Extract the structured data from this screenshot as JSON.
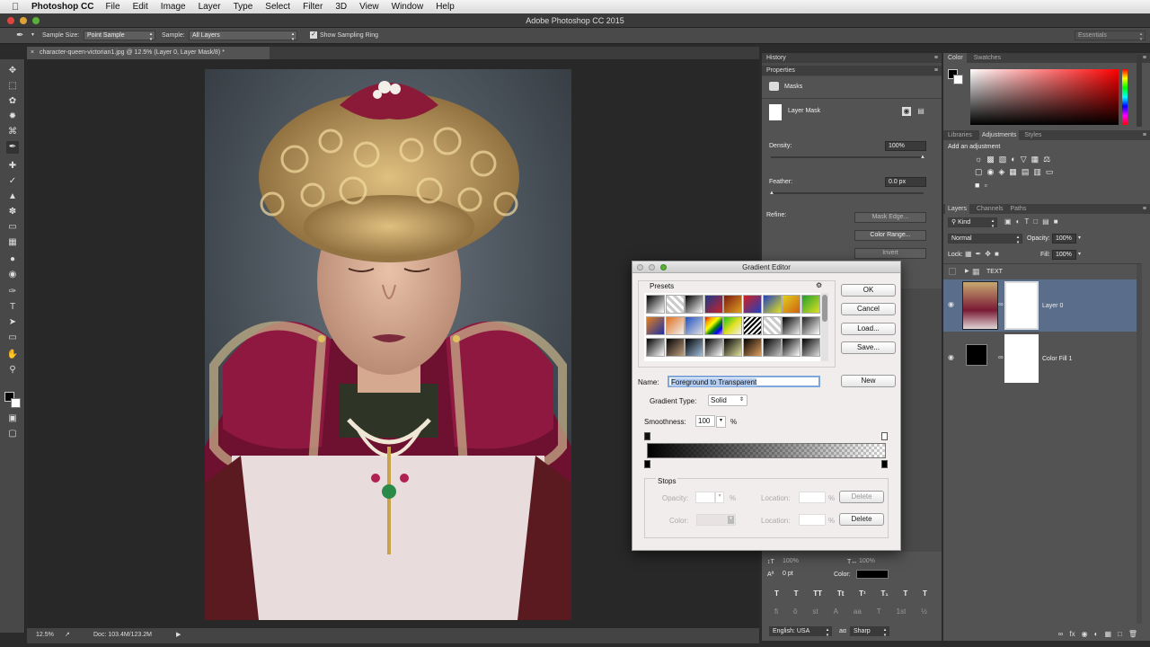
{
  "menubar": {
    "app_name": "Photoshop CC",
    "items": [
      "File",
      "Edit",
      "Image",
      "Layer",
      "Type",
      "Select",
      "Filter",
      "3D",
      "View",
      "Window",
      "Help"
    ]
  },
  "window_title": "Adobe Photoshop CC 2015",
  "options_bar": {
    "sample_size_label": "Sample Size:",
    "sample_size_value": "Point Sample",
    "sample_label": "Sample:",
    "sample_value": "All Layers",
    "show_ring_label": "Show Sampling Ring",
    "workspace": "Essentials"
  },
  "document_tab": "character-queen-victorian1.jpg @ 12.5% (Layer 0, Layer Mask/8) *",
  "status_bar": {
    "zoom": "12.5%",
    "doc_size": "Doc: 103.4M/123.2M"
  },
  "history_panel": {
    "title": "History"
  },
  "properties_panel": {
    "title": "Properties",
    "masks_label": "Masks",
    "layer_mask_label": "Layer Mask",
    "density_label": "Density:",
    "density_value": "100%",
    "feather_label": "Feather:",
    "feather_value": "0.0 px",
    "refine_label": "Refine:",
    "mask_edge_button": "Mask Edge...",
    "color_range_button": "Color Range...",
    "invert_button": "Invert"
  },
  "color_panel": {
    "tabs": [
      "Color",
      "Swatches"
    ]
  },
  "adjustments_panel": {
    "tabs": [
      "Libraries",
      "Adjustments",
      "Styles"
    ],
    "add_label": "Add an adjustment"
  },
  "layers_panel": {
    "tabs": [
      "Layers",
      "Channels",
      "Paths"
    ],
    "kind_filter": "Kind",
    "blend_mode": "Normal",
    "opacity_label": "Opacity:",
    "opacity_value": "100%",
    "lock_label": "Lock:",
    "fill_label": "Fill:",
    "fill_value": "100%",
    "layers": [
      {
        "name": "TEXT"
      },
      {
        "name": "Layer 0"
      },
      {
        "name": "Color Fill 1"
      }
    ]
  },
  "character_panel": {
    "scale_v": "100%",
    "scale_h": "100%",
    "tracking": "0 pt",
    "color_label": "Color:",
    "language": "English: USA",
    "antialias": "Sharp",
    "style_buttons": [
      "T",
      "T",
      "TT",
      "Tt",
      "T¹",
      "T₁",
      "T",
      "T"
    ],
    "opentype_buttons": [
      "fi",
      "ǒ",
      "st",
      "A",
      "aa",
      "T",
      "1st",
      "½"
    ]
  },
  "gradient_editor": {
    "title": "Gradient Editor",
    "presets_label": "Presets",
    "ok_button": "OK",
    "cancel_button": "Cancel",
    "load_button": "Load...",
    "save_button": "Save...",
    "name_label": "Name:",
    "name_value": "Foreground to Transparent",
    "new_button": "New",
    "gradient_type_label": "Gradient Type:",
    "gradient_type_value": "Solid",
    "smoothness_label": "Smoothness:",
    "smoothness_value": "100",
    "percent": "%",
    "stops_label": "Stops",
    "opacity_label": "Opacity:",
    "color_label": "Color:",
    "location_label": "Location:",
    "delete_button": "Delete"
  },
  "colors": {
    "ui_bg": "#535353",
    "dialog_bg": "#f1eded",
    "selected_layer": "#5a6e8c",
    "name_highlight": "#b3cdf2"
  }
}
